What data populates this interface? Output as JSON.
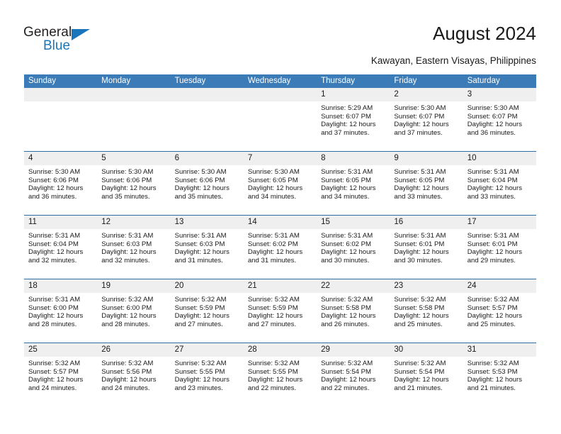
{
  "brand": {
    "name_dark": "General",
    "name_blue": "Blue",
    "accent_color": "#1b75bb"
  },
  "header": {
    "month_title": "August 2024",
    "location": "Kawayan, Eastern Visayas, Philippines"
  },
  "colors": {
    "header_blue": "#3b7cb8",
    "row_divider": "#2e6da4",
    "day_band_gray": "#efefef",
    "text": "#1a1a1a"
  },
  "weekdays": [
    "Sunday",
    "Monday",
    "Tuesday",
    "Wednesday",
    "Thursday",
    "Friday",
    "Saturday"
  ],
  "weeks": [
    [
      {
        "day": "",
        "lines": []
      },
      {
        "day": "",
        "lines": []
      },
      {
        "day": "",
        "lines": []
      },
      {
        "day": "",
        "lines": []
      },
      {
        "day": "1",
        "lines": [
          "Sunrise: 5:29 AM",
          "Sunset: 6:07 PM",
          "Daylight: 12 hours",
          "and 37 minutes."
        ]
      },
      {
        "day": "2",
        "lines": [
          "Sunrise: 5:30 AM",
          "Sunset: 6:07 PM",
          "Daylight: 12 hours",
          "and 37 minutes."
        ]
      },
      {
        "day": "3",
        "lines": [
          "Sunrise: 5:30 AM",
          "Sunset: 6:07 PM",
          "Daylight: 12 hours",
          "and 36 minutes."
        ]
      }
    ],
    [
      {
        "day": "4",
        "lines": [
          "Sunrise: 5:30 AM",
          "Sunset: 6:06 PM",
          "Daylight: 12 hours",
          "and 36 minutes."
        ]
      },
      {
        "day": "5",
        "lines": [
          "Sunrise: 5:30 AM",
          "Sunset: 6:06 PM",
          "Daylight: 12 hours",
          "and 35 minutes."
        ]
      },
      {
        "day": "6",
        "lines": [
          "Sunrise: 5:30 AM",
          "Sunset: 6:06 PM",
          "Daylight: 12 hours",
          "and 35 minutes."
        ]
      },
      {
        "day": "7",
        "lines": [
          "Sunrise: 5:30 AM",
          "Sunset: 6:05 PM",
          "Daylight: 12 hours",
          "and 34 minutes."
        ]
      },
      {
        "day": "8",
        "lines": [
          "Sunrise: 5:31 AM",
          "Sunset: 6:05 PM",
          "Daylight: 12 hours",
          "and 34 minutes."
        ]
      },
      {
        "day": "9",
        "lines": [
          "Sunrise: 5:31 AM",
          "Sunset: 6:05 PM",
          "Daylight: 12 hours",
          "and 33 minutes."
        ]
      },
      {
        "day": "10",
        "lines": [
          "Sunrise: 5:31 AM",
          "Sunset: 6:04 PM",
          "Daylight: 12 hours",
          "and 33 minutes."
        ]
      }
    ],
    [
      {
        "day": "11",
        "lines": [
          "Sunrise: 5:31 AM",
          "Sunset: 6:04 PM",
          "Daylight: 12 hours",
          "and 32 minutes."
        ]
      },
      {
        "day": "12",
        "lines": [
          "Sunrise: 5:31 AM",
          "Sunset: 6:03 PM",
          "Daylight: 12 hours",
          "and 32 minutes."
        ]
      },
      {
        "day": "13",
        "lines": [
          "Sunrise: 5:31 AM",
          "Sunset: 6:03 PM",
          "Daylight: 12 hours",
          "and 31 minutes."
        ]
      },
      {
        "day": "14",
        "lines": [
          "Sunrise: 5:31 AM",
          "Sunset: 6:02 PM",
          "Daylight: 12 hours",
          "and 31 minutes."
        ]
      },
      {
        "day": "15",
        "lines": [
          "Sunrise: 5:31 AM",
          "Sunset: 6:02 PM",
          "Daylight: 12 hours",
          "and 30 minutes."
        ]
      },
      {
        "day": "16",
        "lines": [
          "Sunrise: 5:31 AM",
          "Sunset: 6:01 PM",
          "Daylight: 12 hours",
          "and 30 minutes."
        ]
      },
      {
        "day": "17",
        "lines": [
          "Sunrise: 5:31 AM",
          "Sunset: 6:01 PM",
          "Daylight: 12 hours",
          "and 29 minutes."
        ]
      }
    ],
    [
      {
        "day": "18",
        "lines": [
          "Sunrise: 5:31 AM",
          "Sunset: 6:00 PM",
          "Daylight: 12 hours",
          "and 28 minutes."
        ]
      },
      {
        "day": "19",
        "lines": [
          "Sunrise: 5:32 AM",
          "Sunset: 6:00 PM",
          "Daylight: 12 hours",
          "and 28 minutes."
        ]
      },
      {
        "day": "20",
        "lines": [
          "Sunrise: 5:32 AM",
          "Sunset: 5:59 PM",
          "Daylight: 12 hours",
          "and 27 minutes."
        ]
      },
      {
        "day": "21",
        "lines": [
          "Sunrise: 5:32 AM",
          "Sunset: 5:59 PM",
          "Daylight: 12 hours",
          "and 27 minutes."
        ]
      },
      {
        "day": "22",
        "lines": [
          "Sunrise: 5:32 AM",
          "Sunset: 5:58 PM",
          "Daylight: 12 hours",
          "and 26 minutes."
        ]
      },
      {
        "day": "23",
        "lines": [
          "Sunrise: 5:32 AM",
          "Sunset: 5:58 PM",
          "Daylight: 12 hours",
          "and 25 minutes."
        ]
      },
      {
        "day": "24",
        "lines": [
          "Sunrise: 5:32 AM",
          "Sunset: 5:57 PM",
          "Daylight: 12 hours",
          "and 25 minutes."
        ]
      }
    ],
    [
      {
        "day": "25",
        "lines": [
          "Sunrise: 5:32 AM",
          "Sunset: 5:57 PM",
          "Daylight: 12 hours",
          "and 24 minutes."
        ]
      },
      {
        "day": "26",
        "lines": [
          "Sunrise: 5:32 AM",
          "Sunset: 5:56 PM",
          "Daylight: 12 hours",
          "and 24 minutes."
        ]
      },
      {
        "day": "27",
        "lines": [
          "Sunrise: 5:32 AM",
          "Sunset: 5:55 PM",
          "Daylight: 12 hours",
          "and 23 minutes."
        ]
      },
      {
        "day": "28",
        "lines": [
          "Sunrise: 5:32 AM",
          "Sunset: 5:55 PM",
          "Daylight: 12 hours",
          "and 22 minutes."
        ]
      },
      {
        "day": "29",
        "lines": [
          "Sunrise: 5:32 AM",
          "Sunset: 5:54 PM",
          "Daylight: 12 hours",
          "and 22 minutes."
        ]
      },
      {
        "day": "30",
        "lines": [
          "Sunrise: 5:32 AM",
          "Sunset: 5:54 PM",
          "Daylight: 12 hours",
          "and 21 minutes."
        ]
      },
      {
        "day": "31",
        "lines": [
          "Sunrise: 5:32 AM",
          "Sunset: 5:53 PM",
          "Daylight: 12 hours",
          "and 21 minutes."
        ]
      }
    ]
  ]
}
